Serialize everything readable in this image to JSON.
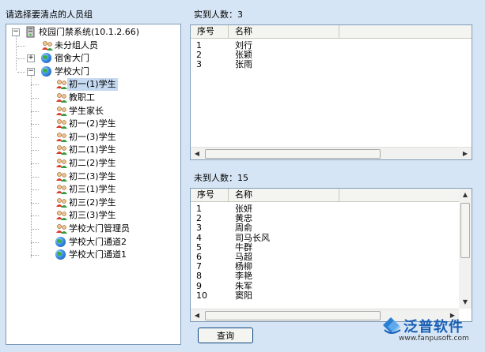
{
  "tree_title": "请选择要清点的人员组",
  "tree": [
    {
      "label": "校园门禁系统(10.1.2.66)",
      "icon": "computer-icon",
      "level": 0,
      "expander": "−"
    },
    {
      "label": "未分组人员",
      "icon": "group-icon",
      "level": 1,
      "expander": ""
    },
    {
      "label": "宿舍大门",
      "icon": "globe-icon",
      "level": 1,
      "expander": "+"
    },
    {
      "label": "学校大门",
      "icon": "globe-icon",
      "level": 1,
      "expander": "−"
    },
    {
      "label": "初一(1)学生",
      "icon": "group-icon",
      "level": 2,
      "expander": "",
      "selected": true
    },
    {
      "label": "教职工",
      "icon": "group-icon",
      "level": 2,
      "expander": ""
    },
    {
      "label": "学生家长",
      "icon": "group-icon",
      "level": 2,
      "expander": ""
    },
    {
      "label": "初一(2)学生",
      "icon": "group-icon",
      "level": 2,
      "expander": ""
    },
    {
      "label": "初一(3)学生",
      "icon": "group-icon",
      "level": 2,
      "expander": ""
    },
    {
      "label": "初二(1)学生",
      "icon": "group-icon",
      "level": 2,
      "expander": ""
    },
    {
      "label": "初二(2)学生",
      "icon": "group-icon",
      "level": 2,
      "expander": ""
    },
    {
      "label": "初二(3)学生",
      "icon": "group-icon",
      "level": 2,
      "expander": ""
    },
    {
      "label": "初三(1)学生",
      "icon": "group-icon",
      "level": 2,
      "expander": ""
    },
    {
      "label": "初三(2)学生",
      "icon": "group-icon",
      "level": 2,
      "expander": ""
    },
    {
      "label": "初三(3)学生",
      "icon": "group-icon",
      "level": 2,
      "expander": ""
    },
    {
      "label": "学校大门管理员",
      "icon": "group-icon",
      "level": 2,
      "expander": ""
    },
    {
      "label": "学校大门通道2",
      "icon": "globe-icon",
      "level": 2,
      "expander": ""
    },
    {
      "label": "学校大门通道1",
      "icon": "globe-icon",
      "level": 2,
      "expander": ""
    }
  ],
  "present": {
    "label": "实到人数：3",
    "columns": [
      "序号",
      "名称"
    ],
    "rows": [
      [
        "1",
        "刘行"
      ],
      [
        "2",
        "张颖"
      ],
      [
        "3",
        "张雨"
      ]
    ]
  },
  "absent": {
    "label": "未到人数：15",
    "columns": [
      "序号",
      "名称"
    ],
    "rows": [
      [
        "1",
        "张妍"
      ],
      [
        "2",
        "黄忠"
      ],
      [
        "3",
        "周俞"
      ],
      [
        "4",
        "司马长风"
      ],
      [
        "5",
        "牛群"
      ],
      [
        "6",
        "马超"
      ],
      [
        "7",
        "杨柳"
      ],
      [
        "8",
        "李艳"
      ],
      [
        "9",
        "朱军"
      ],
      [
        "10",
        "窦阳"
      ]
    ]
  },
  "query_button": "查询",
  "logo": {
    "brand": "泛普软件",
    "url": "www.fanpusoft.com",
    "brand_color": "#1a5fb4"
  }
}
